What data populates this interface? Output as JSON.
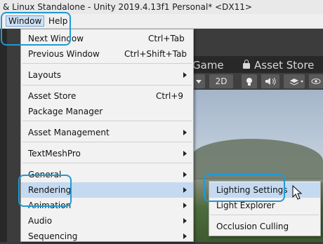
{
  "window": {
    "title": "& Linux Standalone - Unity 2019.4.13f1 Personal* <DX11>"
  },
  "menubar": {
    "window": "Window",
    "help": "Help"
  },
  "editor": {
    "tab_game": "Game",
    "tab_asset_store": "Asset Store",
    "btn_2d": "2D"
  },
  "window_menu": [
    {
      "label": "Next Window",
      "shortcut": "Ctrl+Tab",
      "submenu": false
    },
    {
      "label": "Previous Window",
      "shortcut": "Ctrl+Shift+Tab",
      "submenu": false
    },
    {
      "label": "Layouts",
      "shortcut": "",
      "submenu": true
    },
    {
      "label": "Asset Store",
      "shortcut": "Ctrl+9",
      "submenu": false
    },
    {
      "label": "Package Manager",
      "shortcut": "",
      "submenu": false
    },
    {
      "label": "Asset Management",
      "shortcut": "",
      "submenu": true
    },
    {
      "label": "TextMeshPro",
      "shortcut": "",
      "submenu": true
    },
    {
      "label": "General",
      "shortcut": "",
      "submenu": true
    },
    {
      "label": "Rendering",
      "shortcut": "",
      "submenu": true,
      "highlighted": true
    },
    {
      "label": "Animation",
      "shortcut": "",
      "submenu": true
    },
    {
      "label": "Audio",
      "shortcut": "",
      "submenu": true
    },
    {
      "label": "Sequencing",
      "shortcut": "",
      "submenu": true
    }
  ],
  "rendering_submenu": [
    {
      "label": "Lighting Settings",
      "highlighted": true
    },
    {
      "label": "Light Explorer"
    },
    {
      "label": "Occlusion Culling"
    }
  ],
  "colors": {
    "callout": "#1e9ad6",
    "highlight": "#c5daf0"
  }
}
